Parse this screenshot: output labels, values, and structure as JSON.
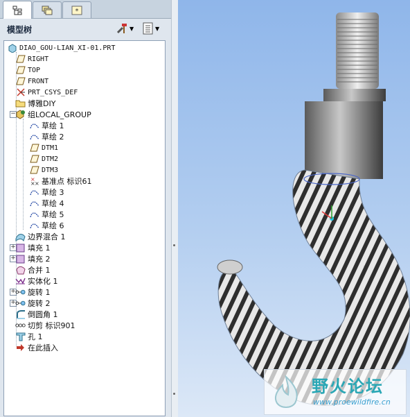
{
  "tabs": [
    {
      "icon": "model-tree-tab-icon",
      "active": true
    },
    {
      "icon": "layers-tab-icon",
      "active": false
    },
    {
      "icon": "favorites-tab-icon",
      "active": false
    }
  ],
  "panel": {
    "title": "模型树"
  },
  "tree": {
    "root": "DIAO_GOU-LIAN_XI-01.PRT",
    "items": [
      {
        "label": "RIGHT",
        "icon": "datum-plane-icon"
      },
      {
        "label": "TOP",
        "icon": "datum-plane-icon"
      },
      {
        "label": "FRONT",
        "icon": "datum-plane-icon"
      },
      {
        "label": "PRT_CSYS_DEF",
        "icon": "csys-icon"
      },
      {
        "label": "博雅DIY",
        "icon": "folder-icon"
      },
      {
        "label": "组LOCAL_GROUP",
        "icon": "group-icon"
      },
      {
        "label": "草绘 1",
        "icon": "sketch-icon"
      },
      {
        "label": "草绘 2",
        "icon": "sketch-icon"
      },
      {
        "label": "DTM1",
        "icon": "datum-plane-icon"
      },
      {
        "label": "DTM2",
        "icon": "datum-plane-icon"
      },
      {
        "label": "DTM3",
        "icon": "datum-plane-icon"
      },
      {
        "label": "基准点 标识61",
        "icon": "datum-point-icon"
      },
      {
        "label": "草绘 3",
        "icon": "sketch-icon"
      },
      {
        "label": "草绘 4",
        "icon": "sketch-icon"
      },
      {
        "label": "草绘 5",
        "icon": "sketch-icon"
      },
      {
        "label": "草绘 6",
        "icon": "sketch-icon"
      },
      {
        "label": "边界混合 1",
        "icon": "boundary-blend-icon"
      },
      {
        "label": "填充 1",
        "icon": "fill-icon"
      },
      {
        "label": "填充 2",
        "icon": "fill-icon"
      },
      {
        "label": "合并 1",
        "icon": "merge-icon"
      },
      {
        "label": "实体化 1",
        "icon": "solidify-icon"
      },
      {
        "label": "旋转 1",
        "icon": "revolve-icon"
      },
      {
        "label": "旋转 2",
        "icon": "revolve-icon"
      },
      {
        "label": "倒圆角 1",
        "icon": "round-icon"
      },
      {
        "label": "切剪 标识901",
        "icon": "cut-icon"
      },
      {
        "label": "孔 1",
        "icon": "hole-icon"
      },
      {
        "label": "在此插入",
        "icon": "insert-here-icon"
      }
    ]
  },
  "watermark": {
    "title": "野火论坛",
    "url": "www.proewildfire.cn"
  }
}
